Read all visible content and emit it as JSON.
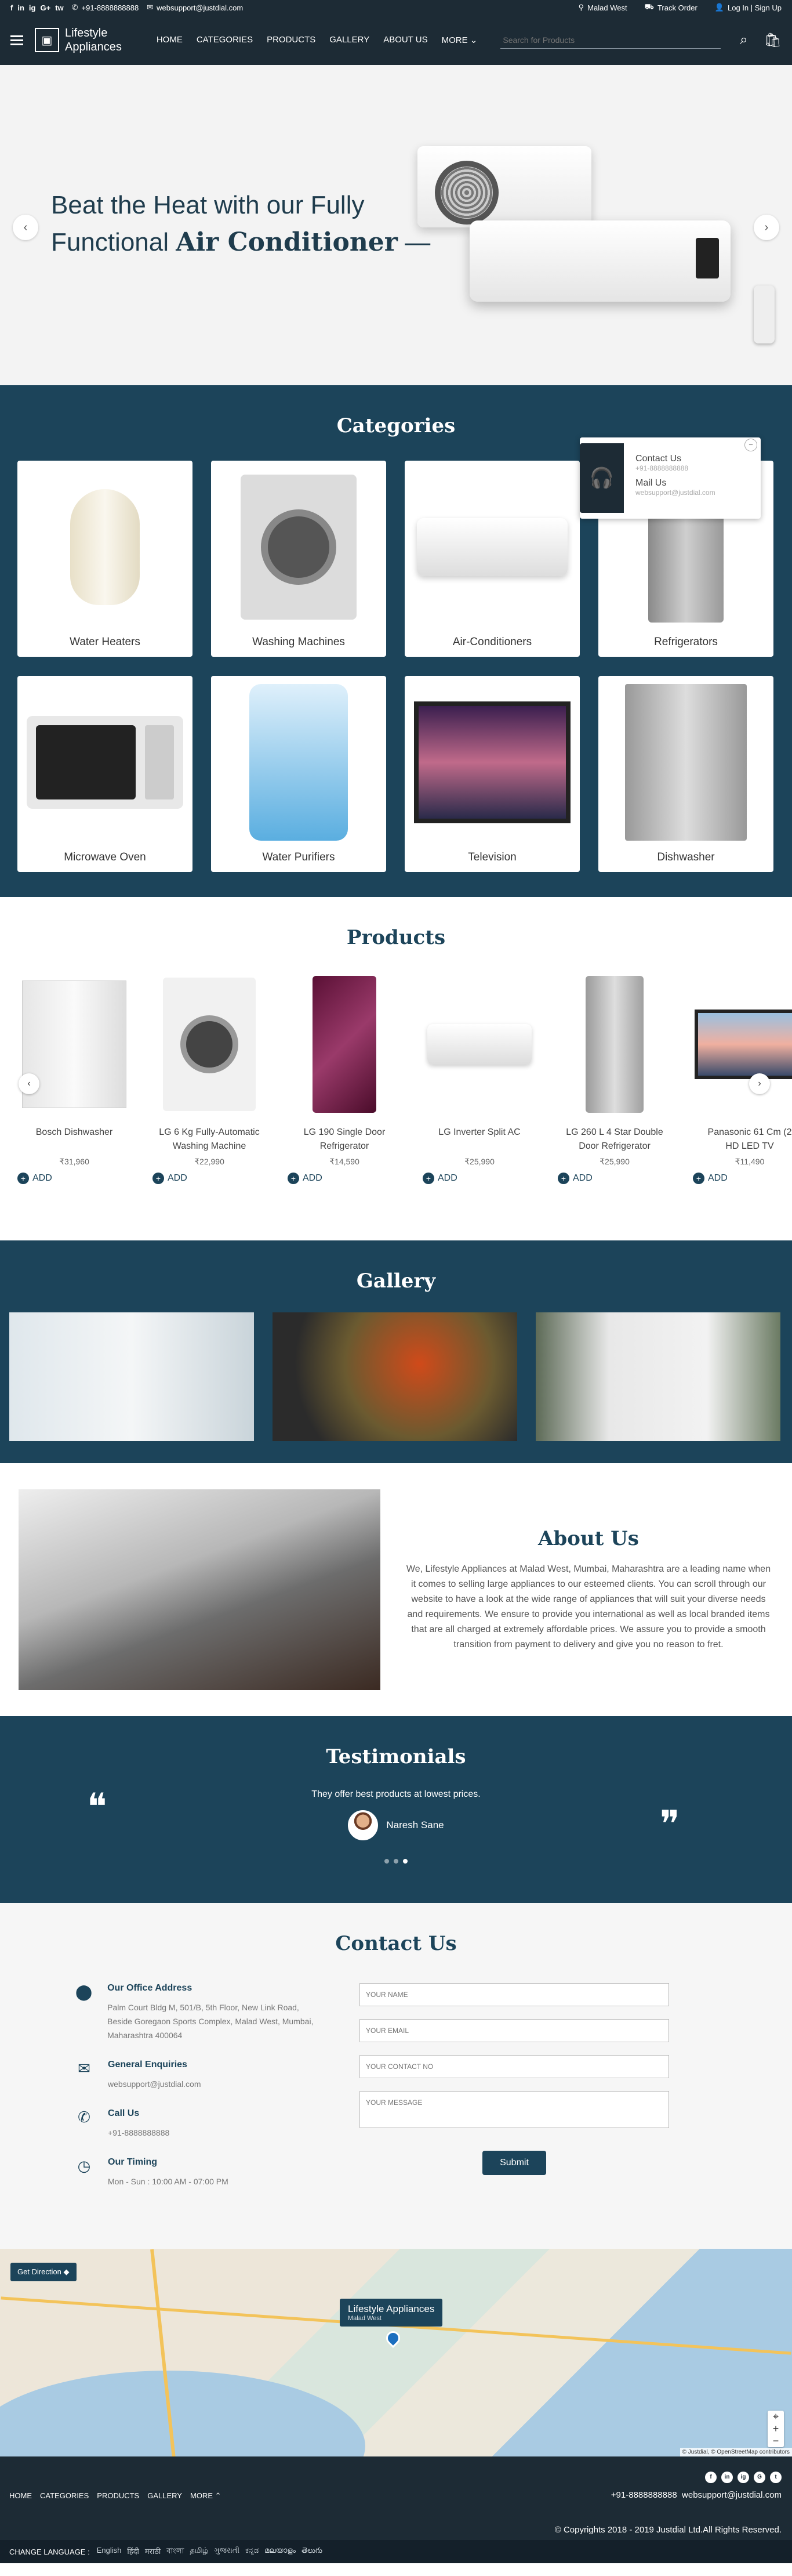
{
  "topbar": {
    "social": [
      "f",
      "in",
      "ig",
      "G+",
      "tw"
    ],
    "phone": "+91-8888888888",
    "email": "websupport@justdial.com",
    "location": "Malad West",
    "track": "Track Order",
    "login": "Log In | Sign Up"
  },
  "header": {
    "logo_line1": "Lifestyle",
    "logo_line2": "Appliances",
    "nav": [
      "HOME",
      "CATEGORIES",
      "PRODUCTS",
      "GALLERY",
      "ABOUT US",
      "MORE"
    ],
    "search_placeholder": "Search for Products"
  },
  "hero": {
    "line1": "Beat the Heat with our Fully",
    "line2_prefix": "Functional ",
    "line2_bold": "Air Conditioner",
    "line2_suffix": " —"
  },
  "categories": {
    "title": "Categories",
    "items": [
      {
        "label": "Water Heaters",
        "icon": "water-heater"
      },
      {
        "label": "Washing Machines",
        "icon": "washing-machine"
      },
      {
        "label": "Air-Conditioners",
        "icon": "air-conditioner"
      },
      {
        "label": "Refrigerators",
        "icon": "refrigerator"
      },
      {
        "label": "Microwave Oven",
        "icon": "microwave"
      },
      {
        "label": "Water Purifiers",
        "icon": "water-purifier"
      },
      {
        "label": "Television",
        "icon": "television"
      },
      {
        "label": "Dishwasher",
        "icon": "dishwasher"
      }
    ],
    "popup": {
      "contact_label": "Contact Us",
      "contact_value": "+91-8888888888",
      "mail_label": "Mail Us",
      "mail_value": "websupport@justdial.com"
    }
  },
  "products": {
    "title": "Products",
    "add_label": "ADD",
    "items": [
      {
        "name": "Bosch Dishwasher",
        "name2": "",
        "price": "₹31,960"
      },
      {
        "name": "LG 6 Kg Fully-Automatic",
        "name2": "Washing Machine",
        "price": "₹22,990"
      },
      {
        "name": "LG 190 Single Door",
        "name2": "Refrigerator",
        "price": "₹14,590"
      },
      {
        "name": "LG Inverter Split AC",
        "name2": "",
        "price": "₹25,990"
      },
      {
        "name": "LG 260 L 4 Star Double",
        "name2": "Door Refrigerator",
        "price": "₹25,990"
      },
      {
        "name": "Panasonic 61 Cm (2",
        "name2": "HD LED TV",
        "price": "₹11,490"
      }
    ]
  },
  "gallery": {
    "title": "Gallery"
  },
  "about": {
    "title": "About Us",
    "text": "We, Lifestyle Appliances at Malad West, Mumbai, Maharashtra are a leading name when it comes to selling large appliances to our esteemed clients. You can scroll through our website to have a look at the wide range of appliances that will suit your diverse needs and requirements. We ensure to provide you international as well as local branded items that are all charged at extremely affordable prices. We assure you to provide a smooth transition from payment to delivery and give you no reason to fret."
  },
  "testimonials": {
    "title": "Testimonials",
    "quote": "They offer best products at lowest prices.",
    "author": "Naresh Sane"
  },
  "contact": {
    "title": "Contact Us",
    "address_title": "Our Office Address",
    "address": "Palm Court Bldg M, 501/B, 5th Floor, New Link Road, Beside Goregaon Sports Complex, Malad West, Mumbai, Maharashtra 400064",
    "enquiry_title": "General Enquiries",
    "enquiry": "websupport@justdial.com",
    "call_title": "Call Us",
    "call": "+91-8888888888",
    "timing_title": "Our Timing",
    "timing": "Mon - Sun : 10:00 AM - 07:00 PM",
    "form": {
      "name": "YOUR NAME",
      "email": "YOUR EMAIL",
      "phone": "YOUR CONTACT NO",
      "message": "YOUR MESSAGE",
      "submit": "Submit"
    }
  },
  "map": {
    "direction": "Get Direction",
    "label": "Lifestyle Appliances",
    "sublabel": "Malad West",
    "attribution": "© Justdial, © OpenStreetMap contributors"
  },
  "footer": {
    "nav": [
      "HOME",
      "CATEGORIES",
      "PRODUCTS",
      "GALLERY",
      "MORE"
    ],
    "phone": "+91-8888888888",
    "email": "websupport@justdial.com",
    "copyright": "© Copyrights 2018 - 2019 Justdial Ltd.All Rights Reserved.",
    "change_language": "CHANGE LANGUAGE :",
    "languages": [
      "English",
      "हिंदी",
      "मराठी",
      "বাংলা",
      "தமிழ்",
      "ગુજરાતી",
      "ಕನ್ನಡ",
      "മലയാളം",
      "తెలుగు"
    ]
  }
}
